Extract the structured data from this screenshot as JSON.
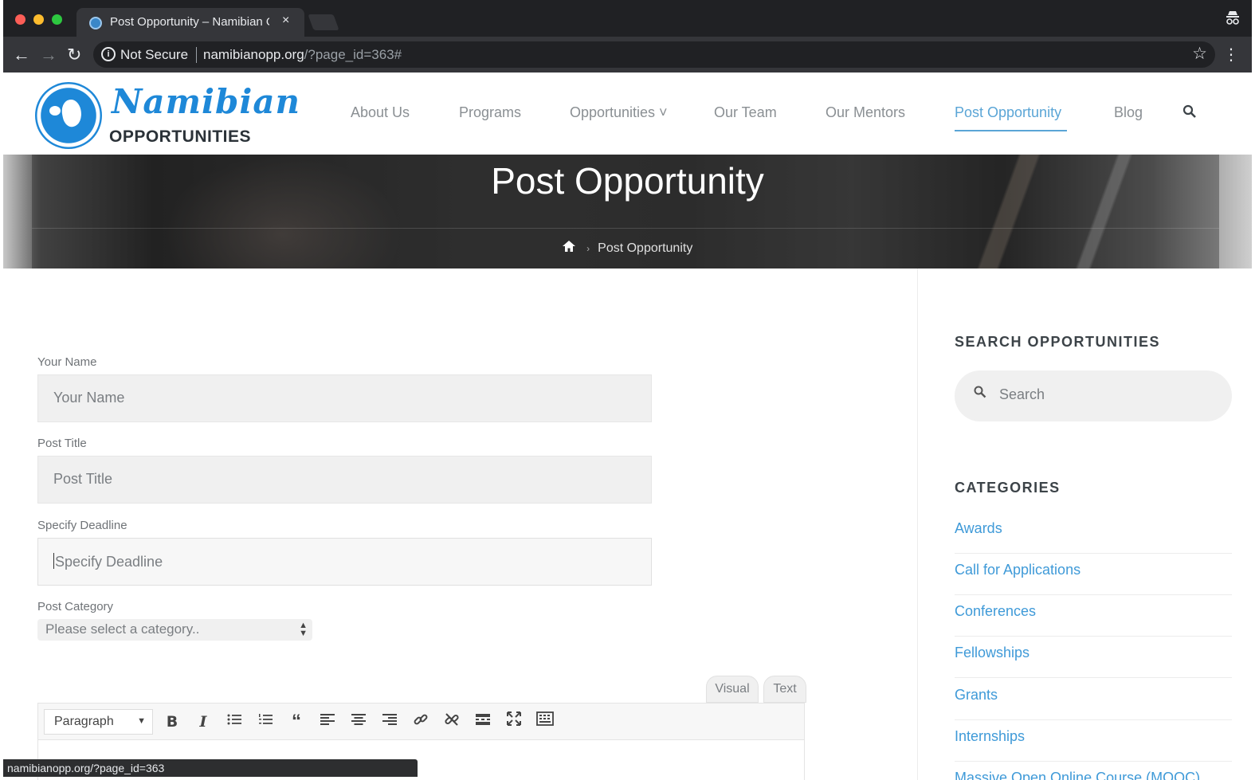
{
  "browser": {
    "tab_title": "Post Opportunity – Namibian O",
    "tab_close": "×",
    "security_label": "Not Secure",
    "url_host": "namibianopp.org",
    "url_path": "/?page_id=363#",
    "status_url": "namibianopp.org/?page_id=363"
  },
  "site": {
    "logo_script": "Namibian",
    "logo_sub": "OPPORTUNITIES",
    "nav": [
      {
        "label": "About Us"
      },
      {
        "label": "Programs"
      },
      {
        "label": "Opportunities ˅"
      },
      {
        "label": "Our Team"
      },
      {
        "label": "Our Mentors"
      },
      {
        "label": "Post Opportunity",
        "active": true
      },
      {
        "label": "Blog"
      }
    ]
  },
  "hero": {
    "title": "Post Opportunity",
    "breadcrumb_current": "Post Opportunity"
  },
  "form": {
    "your_name": {
      "label": "Your Name",
      "placeholder": "Your Name"
    },
    "post_title": {
      "label": "Post Title",
      "placeholder": "Post Title"
    },
    "deadline": {
      "label": "Specify Deadline",
      "placeholder": "Specify Deadline"
    },
    "category": {
      "label": "Post Category",
      "selected": "Please select a category.."
    },
    "editor": {
      "tab_visual": "Visual",
      "tab_text": "Text",
      "format": "Paragraph"
    }
  },
  "sidebar": {
    "search_title": "SEARCH OPPORTUNITIES",
    "search_placeholder": "Search",
    "categories_title": "CATEGORIES",
    "categories": [
      {
        "label": "Awards"
      },
      {
        "label": "Call for Applications"
      },
      {
        "label": "Conferences"
      },
      {
        "label": "Fellowships"
      },
      {
        "label": "Grants"
      },
      {
        "label": "Internships"
      },
      {
        "label": "Massive Open Online Course (MOOC)"
      }
    ]
  },
  "colors": {
    "accent": "#3f9ad8",
    "brand_blue": "#1e88d8",
    "nav_active": "#5aa5d6"
  }
}
